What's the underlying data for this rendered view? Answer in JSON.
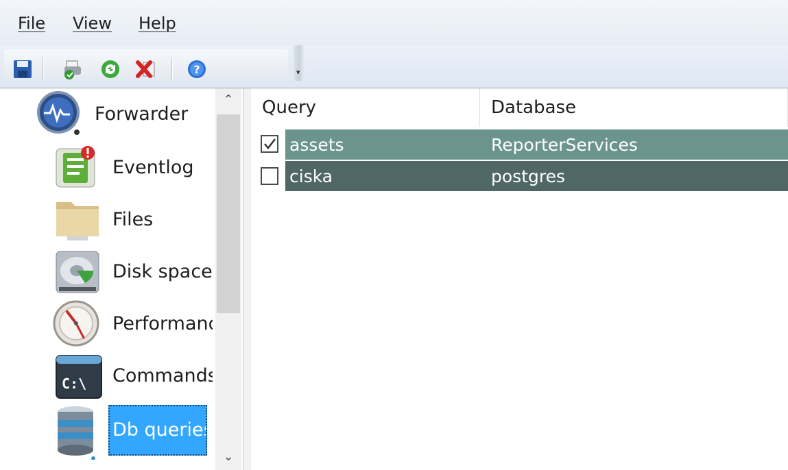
{
  "menu": {
    "file": "File",
    "view": "View",
    "help": "Help"
  },
  "toolbar": {
    "buttons": [
      "save-icon",
      "print-icon",
      "refresh-icon",
      "delete-icon",
      "help-icon"
    ]
  },
  "sidebar": {
    "items": [
      {
        "label": "Forwarder",
        "icon": "forwarder-icon"
      },
      {
        "label": "Eventlog",
        "icon": "eventlog-icon"
      },
      {
        "label": "Files",
        "icon": "folder-icon"
      },
      {
        "label": "Disk space",
        "icon": "disk-icon"
      },
      {
        "label": "Performanc",
        "icon": "gauge-icon"
      },
      {
        "label": "Commands",
        "icon": "terminal-icon"
      },
      {
        "label": "Db queries",
        "icon": "database-icon",
        "selected": true
      }
    ],
    "command_icon_text": "C:\\"
  },
  "list": {
    "columns": [
      "Query",
      "Database"
    ],
    "rows": [
      {
        "checked": true,
        "query": "assets",
        "database": "ReporterServices",
        "bg": "#6b948f"
      },
      {
        "checked": false,
        "query": "ciska",
        "database": "postgres",
        "bg": "#4f6765"
      }
    ]
  },
  "colors": {
    "selection": "#33a7ff",
    "row1": "#6b948f",
    "row2": "#4f6765"
  }
}
